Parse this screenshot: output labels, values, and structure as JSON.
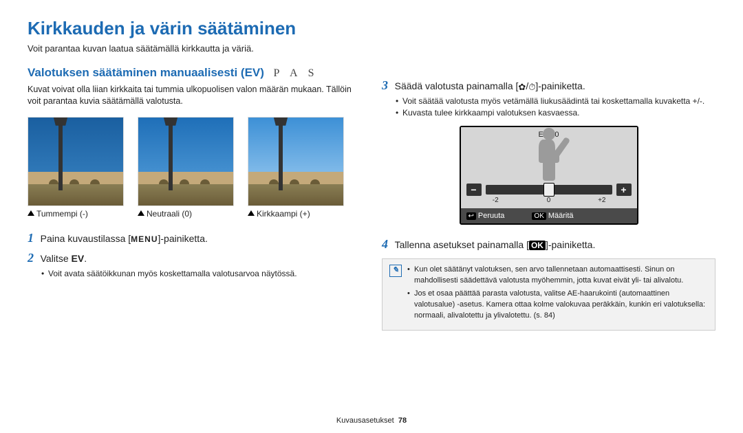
{
  "title": "Kirkkauden ja värin säätäminen",
  "subtitle": "Voit parantaa kuvan laatua säätämällä kirkkautta ja väriä.",
  "left": {
    "heading": "Valotuksen säätäminen manuaalisesti (EV)",
    "modes": "P A S",
    "intro": "Kuvat voivat olla liian kirkkaita tai tummia ulkopuolisen valon määrän mukaan. Tällöin voit parantaa kuvia säätämällä valotusta.",
    "thumbs": [
      {
        "caption": "Tummempi (-)"
      },
      {
        "caption": "Neutraali (0)"
      },
      {
        "caption": "Kirkkaampi (+)"
      }
    ],
    "step1_pre": "Paina kuvaustilassa [",
    "step1_btn": "MENU",
    "step1_post": "]-painiketta.",
    "step2_pre": "Valitse ",
    "step2_bold": "EV",
    "step2_post": ".",
    "step2_bullet": "Voit avata säätöikkunan myös koskettamalla valotusarvoa näytössä."
  },
  "right": {
    "step3_pre": "Säädä valotusta painamalla [",
    "step3_glyph1": "✿",
    "step3_sep": "/",
    "step3_glyph2": "⏱",
    "step3_post": "]-painiketta.",
    "step3_bullets": [
      "Voit säätää valotusta myös vetämällä liukusäädintä tai koskettamalla kuvaketta +/-.",
      "Kuvasta tulee kirkkaampi valotuksen kasvaessa."
    ],
    "lcd": {
      "ev_label": "EV : 0",
      "ticks": {
        "l": "-2",
        "c": "0",
        "r": "+2"
      },
      "cancel_key": "↩",
      "cancel": "Peruuta",
      "ok_key": "OK",
      "ok": "Määritä",
      "minus": "−",
      "plus": "+"
    },
    "step4_pre": "Tallenna asetukset painamalla [",
    "step4_btn": "OK",
    "step4_post": "]-painiketta.",
    "note": [
      "Kun olet säätänyt valotuksen, sen arvo tallennetaan automaattisesti. Sinun on mahdollisesti säädettävä valotusta myöhemmin, jotta kuvat eivät yli- tai alivalotu.",
      "Jos et osaa päättää parasta valotusta, valitse AE-haarukointi (automaattinen valotusalue) -asetus. Kamera ottaa kolme valokuvaa peräkkäin, kunkin eri valotuksella: normaali, alivalotettu ja ylivalotettu. (s. 84)"
    ],
    "note_bold": "AE-haarukointi"
  },
  "footer": {
    "section": "Kuvausasetukset",
    "page": "78"
  }
}
